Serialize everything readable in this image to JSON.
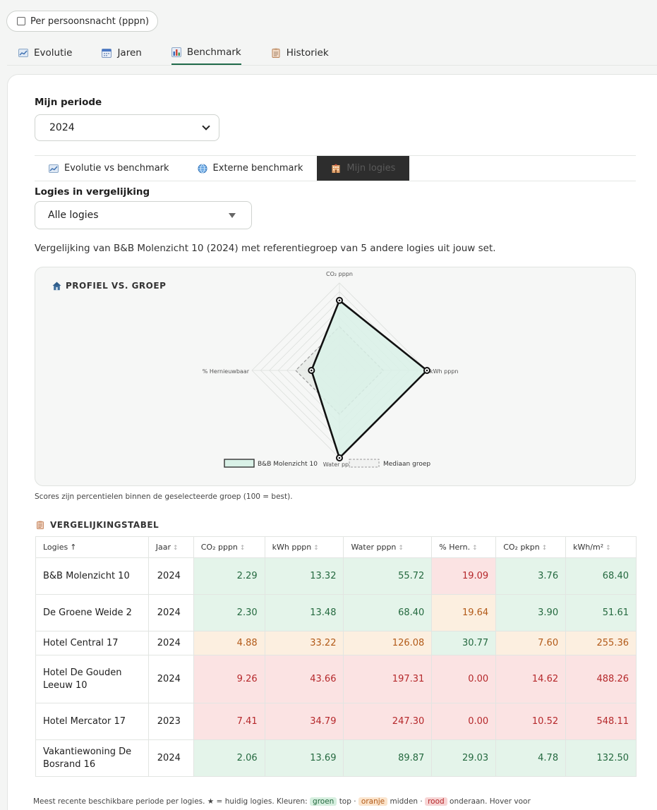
{
  "toggle": {
    "label": "Per persoonsnacht (pppn)",
    "checked": false
  },
  "main_tabs": [
    {
      "label": "Evolutie",
      "icon": "chart-line-icon",
      "active": false
    },
    {
      "label": "Jaren",
      "icon": "calendar-icon",
      "active": false
    },
    {
      "label": "Benchmark",
      "icon": "bar-chart-icon",
      "active": true
    },
    {
      "label": "Historiek",
      "icon": "clipboard-icon",
      "active": false
    }
  ],
  "periode": {
    "label": "Mijn periode",
    "value": "2024"
  },
  "sub_tabs": [
    {
      "label": "Evolutie vs benchmark",
      "icon": "chart-line-icon",
      "active": false
    },
    {
      "label": "Externe benchmark",
      "icon": "globe-icon",
      "active": false
    },
    {
      "label": "Mijn logies",
      "icon": "hotel-icon",
      "active": true
    }
  ],
  "logies": {
    "label": "Logies in vergelijking",
    "value": "Alle logies"
  },
  "comparison_text": "Vergelijking van B&B Molenzicht 10 (2024) met referentiegroep van 5 andere logies uit jouw set.",
  "radar": {
    "title": "PROFIEL VS. GROEP",
    "icon": "house-icon",
    "axes": [
      "CO₂ pppn",
      "kWh pppn",
      "Water pppn",
      "% Hernieuwbaar"
    ],
    "series_name": "B&B Molenzicht 10",
    "series_values": [
      80,
      100,
      100,
      32
    ],
    "median_name": "Mediaan groep",
    "median_values": [
      50,
      50,
      50,
      50
    ],
    "max": 100,
    "levels": 10,
    "series_color": "#111111",
    "series_fill": "#d9f1e7",
    "median_color": "#9a9a9a"
  },
  "scores_note": "Scores zijn percentielen binnen de geselecteerde groep (100 = best).",
  "table": {
    "title": "VERGELIJKINGSTABEL",
    "icon": "clipboard-icon",
    "headers": [
      {
        "label": "Logies",
        "sort": "↑"
      },
      {
        "label": "Jaar",
        "sort": "↕"
      },
      {
        "label": "CO₂ pppn",
        "sort": "↕"
      },
      {
        "label": "kWh pppn",
        "sort": "↕"
      },
      {
        "label": "Water pppn",
        "sort": "↕"
      },
      {
        "label": "% Hern.",
        "sort": "↕"
      },
      {
        "label": "CO₂ pkpn",
        "sort": "↕"
      },
      {
        "label": "kWh/m²",
        "sort": "↕"
      }
    ],
    "rows": [
      {
        "name": "B&B Molenzicht 10",
        "jaar": "2024",
        "cells": [
          [
            "2.29",
            "g"
          ],
          [
            "13.32",
            "g"
          ],
          [
            "55.72",
            "g"
          ],
          [
            "19.09",
            "r"
          ],
          [
            "3.76",
            "g"
          ],
          [
            "68.40",
            "g"
          ]
        ]
      },
      {
        "name": "De Groene Weide 2",
        "jaar": "2024",
        "cells": [
          [
            "2.30",
            "g"
          ],
          [
            "13.48",
            "g"
          ],
          [
            "68.40",
            "g"
          ],
          [
            "19.64",
            "o"
          ],
          [
            "3.90",
            "g"
          ],
          [
            "51.61",
            "g"
          ]
        ]
      },
      {
        "name": "Hotel Central 17",
        "jaar": "2024",
        "cells": [
          [
            "4.88",
            "o"
          ],
          [
            "33.22",
            "o"
          ],
          [
            "126.08",
            "o"
          ],
          [
            "30.77",
            "g"
          ],
          [
            "7.60",
            "o"
          ],
          [
            "255.36",
            "o"
          ]
        ]
      },
      {
        "name": "Hotel De Gouden Leeuw 10",
        "jaar": "2024",
        "cells": [
          [
            "9.26",
            "r"
          ],
          [
            "43.66",
            "r"
          ],
          [
            "197.31",
            "r"
          ],
          [
            "0.00",
            "r"
          ],
          [
            "14.62",
            "r"
          ],
          [
            "488.26",
            "r"
          ]
        ]
      },
      {
        "name": "Hotel Mercator 17",
        "jaar": "2023",
        "cells": [
          [
            "7.41",
            "r"
          ],
          [
            "34.79",
            "r"
          ],
          [
            "247.30",
            "r"
          ],
          [
            "0.00",
            "r"
          ],
          [
            "10.52",
            "r"
          ],
          [
            "548.11",
            "r"
          ]
        ]
      },
      {
        "name": "Vakantiewoning De Bosrand 16",
        "jaar": "2024",
        "cells": [
          [
            "2.06",
            "g"
          ],
          [
            "13.69",
            "g"
          ],
          [
            "89.87",
            "g"
          ],
          [
            "29.03",
            "g"
          ],
          [
            "4.78",
            "g"
          ],
          [
            "132.50",
            "g"
          ]
        ]
      }
    ]
  },
  "footer": {
    "prefix": "Meest recente beschikbare periode per logies. ★ = huidig logies. Kleuren:",
    "green": "groen",
    "green_text": "top ·",
    "orange": "oranje",
    "orange_text": "midden ·",
    "red": "rood",
    "red_text": "onderaan. Hover voor"
  }
}
